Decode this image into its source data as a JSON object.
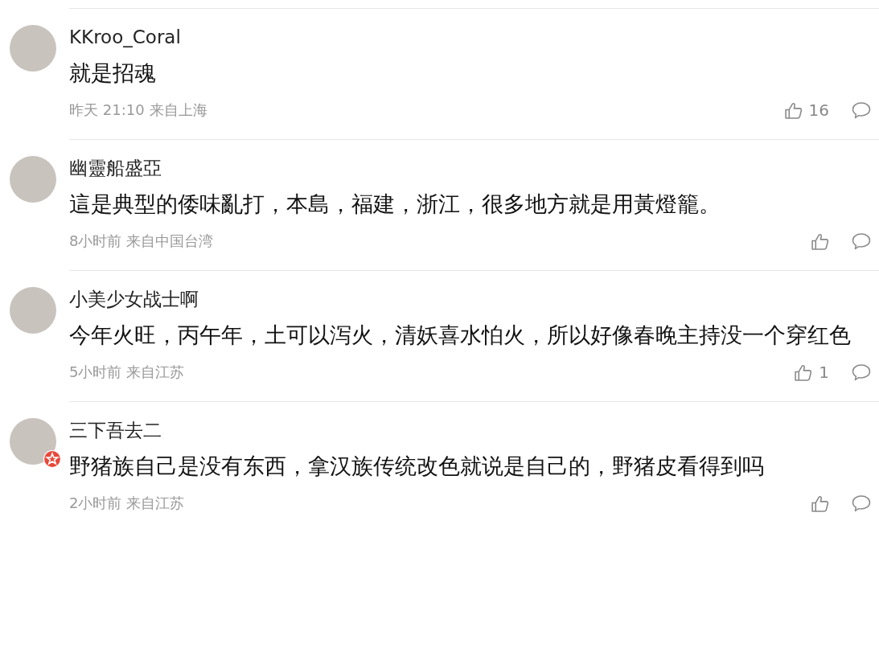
{
  "comments": [
    {
      "username": "KKroo_Coral",
      "verified": false,
      "text": "就是招魂",
      "time": "昨天 21:10",
      "location": "来自上海",
      "likes": "16"
    },
    {
      "username": "幽靈船盛亞",
      "verified": false,
      "text": "這是典型的倭味亂打，本島，福建，浙江，很多地方就是用黃燈籠。",
      "time": "8小时前",
      "location": "来自中国台湾"
    },
    {
      "username": "小美少女战士啊",
      "verified": false,
      "text": "今年火旺，丙午年，土可以泻火，清妖喜水怕火，所以好像春晚主持没一个穿红色",
      "time": "5小时前",
      "location": "来自江苏",
      "likes": "1"
    },
    {
      "username": "三下吾去二",
      "verified": true,
      "text": "野猪族自己是没有东西，拿汉族传统改色就说是自己的，野猪皮看得到吗",
      "time": "2小时前",
      "location": "来自江苏"
    }
  ]
}
